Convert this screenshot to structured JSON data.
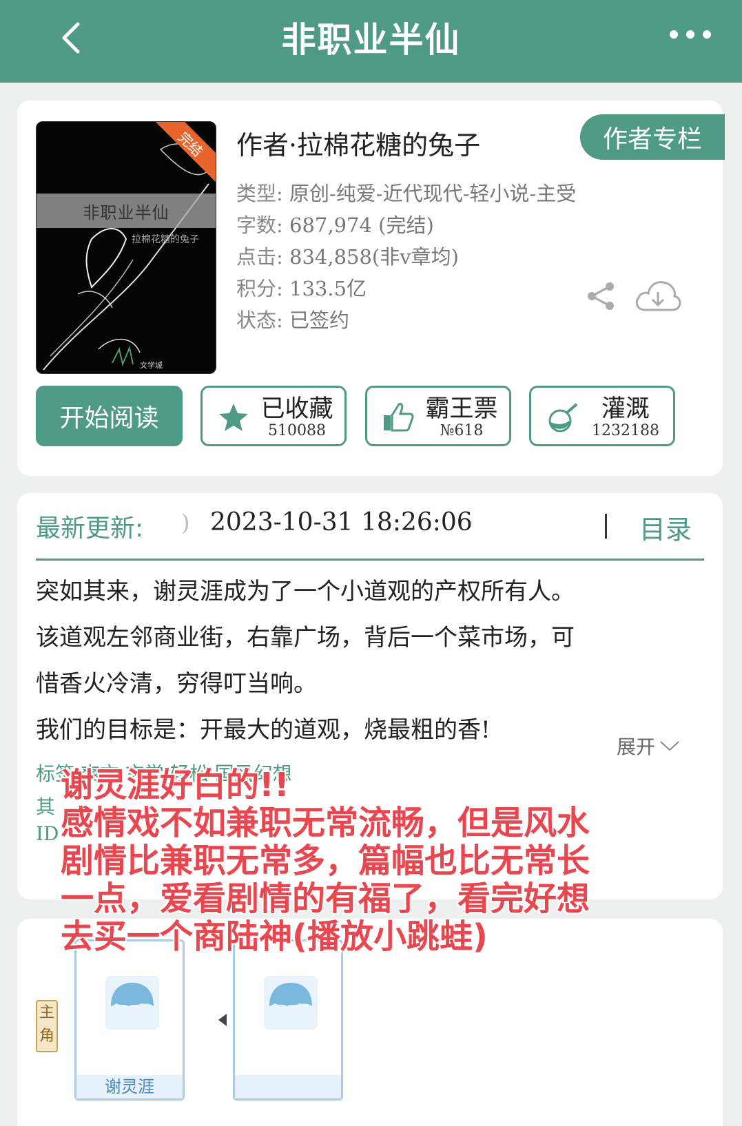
{
  "header": {
    "title": "非职业半仙"
  },
  "book": {
    "cover_title": "非职业半仙",
    "cover_author": "拉棉花糖的兔子",
    "cover_badge": "完结",
    "cover_logo": "文学城",
    "author_line": "作者·拉棉花糖的兔子",
    "author_column_label": "作者专栏",
    "info": [
      {
        "label": "类型:",
        "value": "原创-纯爱-近代现代-轻小说-主受"
      },
      {
        "label": "字数:",
        "value": "687,974 (完结)"
      },
      {
        "label": "点击:",
        "value": "834,858(非v章均)"
      },
      {
        "label": "积分:",
        "value": "133.5亿"
      },
      {
        "label": "状态:",
        "value": "已签约"
      }
    ]
  },
  "actions": {
    "start_read": "开始阅读",
    "favorite": {
      "label": "已收藏",
      "count": "510088"
    },
    "ticket": {
      "label": "霸王票",
      "count": "№618"
    },
    "nutrient": {
      "label": "灌溉",
      "count": "1232188"
    }
  },
  "latest": {
    "label": "最新更新:",
    "paren": ")",
    "time": "2023-10-31 18:26:06",
    "toc": "目录"
  },
  "summary": [
    "突如其来，谢灵涯成为了一个小道观的产权所有人。",
    "该道观左邻商业街，右靠广场，背后一个菜市场，可",
    "惜香火冷清，穷得叮当响。",
    "我们的目标是：开最大的道观，烧最粗的香!"
  ],
  "expand_label": "展开",
  "tags_partial": {
    "line1": "标签                                  爽文 玄学 轻松 国风幻想",
    "line2": "其",
    "line3": "ID"
  },
  "overlay_note": [
    "谢灵涯好白的!!",
    "感情戏不如兼职无常流畅，但是风水",
    "剧情比兼职无常多，篇幅也比无常长",
    "一点，爱看剧情的有福了，看完好想",
    "去买一个商陆神(播放小跳蛙)"
  ],
  "characters": {
    "role_tag": "主角",
    "list": [
      {
        "name": "谢灵涯"
      },
      {
        "name": ""
      }
    ]
  },
  "colors": {
    "accent": "#4e9a86",
    "note": "#e8474f",
    "ribbon": "#e8642c"
  }
}
